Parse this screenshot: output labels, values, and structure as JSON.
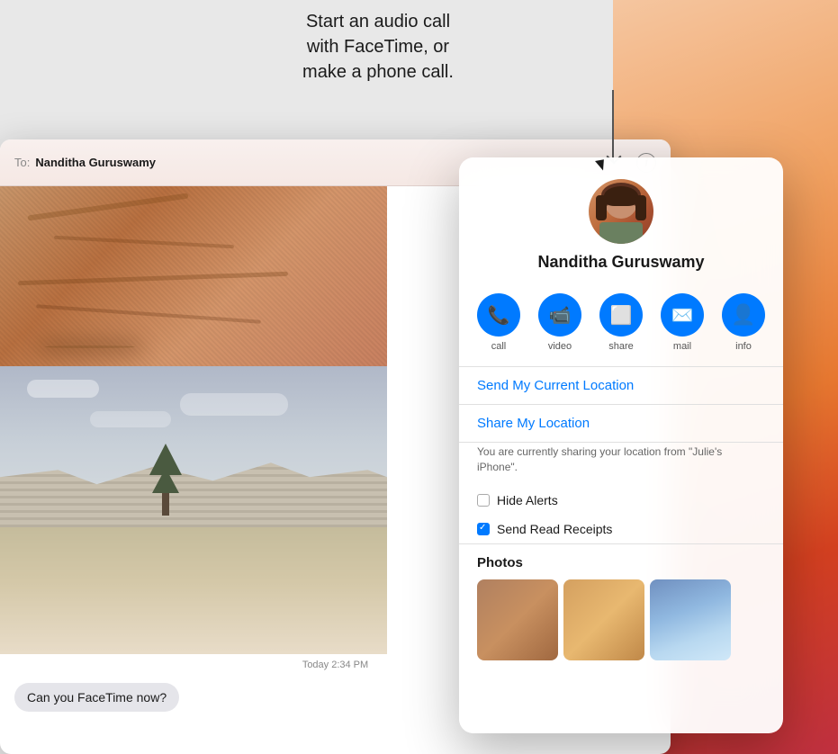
{
  "callout": {
    "text": "Start an audio call\nwith FaceTime, or\nmake a phone call."
  },
  "header": {
    "to_label": "To:",
    "contact_name": "Nanditha Guruswamy",
    "info_button": "i"
  },
  "contact_panel": {
    "contact_name": "Nanditha Guruswamy",
    "actions": [
      {
        "id": "call",
        "label": "call",
        "icon": "📞"
      },
      {
        "id": "video",
        "label": "video",
        "icon": "📹"
      },
      {
        "id": "share",
        "label": "share",
        "icon": "🔗"
      },
      {
        "id": "mail",
        "label": "mail",
        "icon": "✉️"
      },
      {
        "id": "info",
        "label": "info",
        "icon": "👤"
      }
    ],
    "send_location_link": "Send My Current Location",
    "share_location_link": "Share My Location",
    "location_sharing_text": "You are currently sharing your location from \"Julie's iPhone\".",
    "hide_alerts_label": "Hide Alerts",
    "hide_alerts_checked": false,
    "send_read_receipts_label": "Send Read Receipts",
    "send_read_receipts_checked": true,
    "photos_title": "Photos"
  },
  "message": {
    "timestamp": "Today 2:34 PM",
    "bubble_text": "Can you FaceTime now?"
  }
}
